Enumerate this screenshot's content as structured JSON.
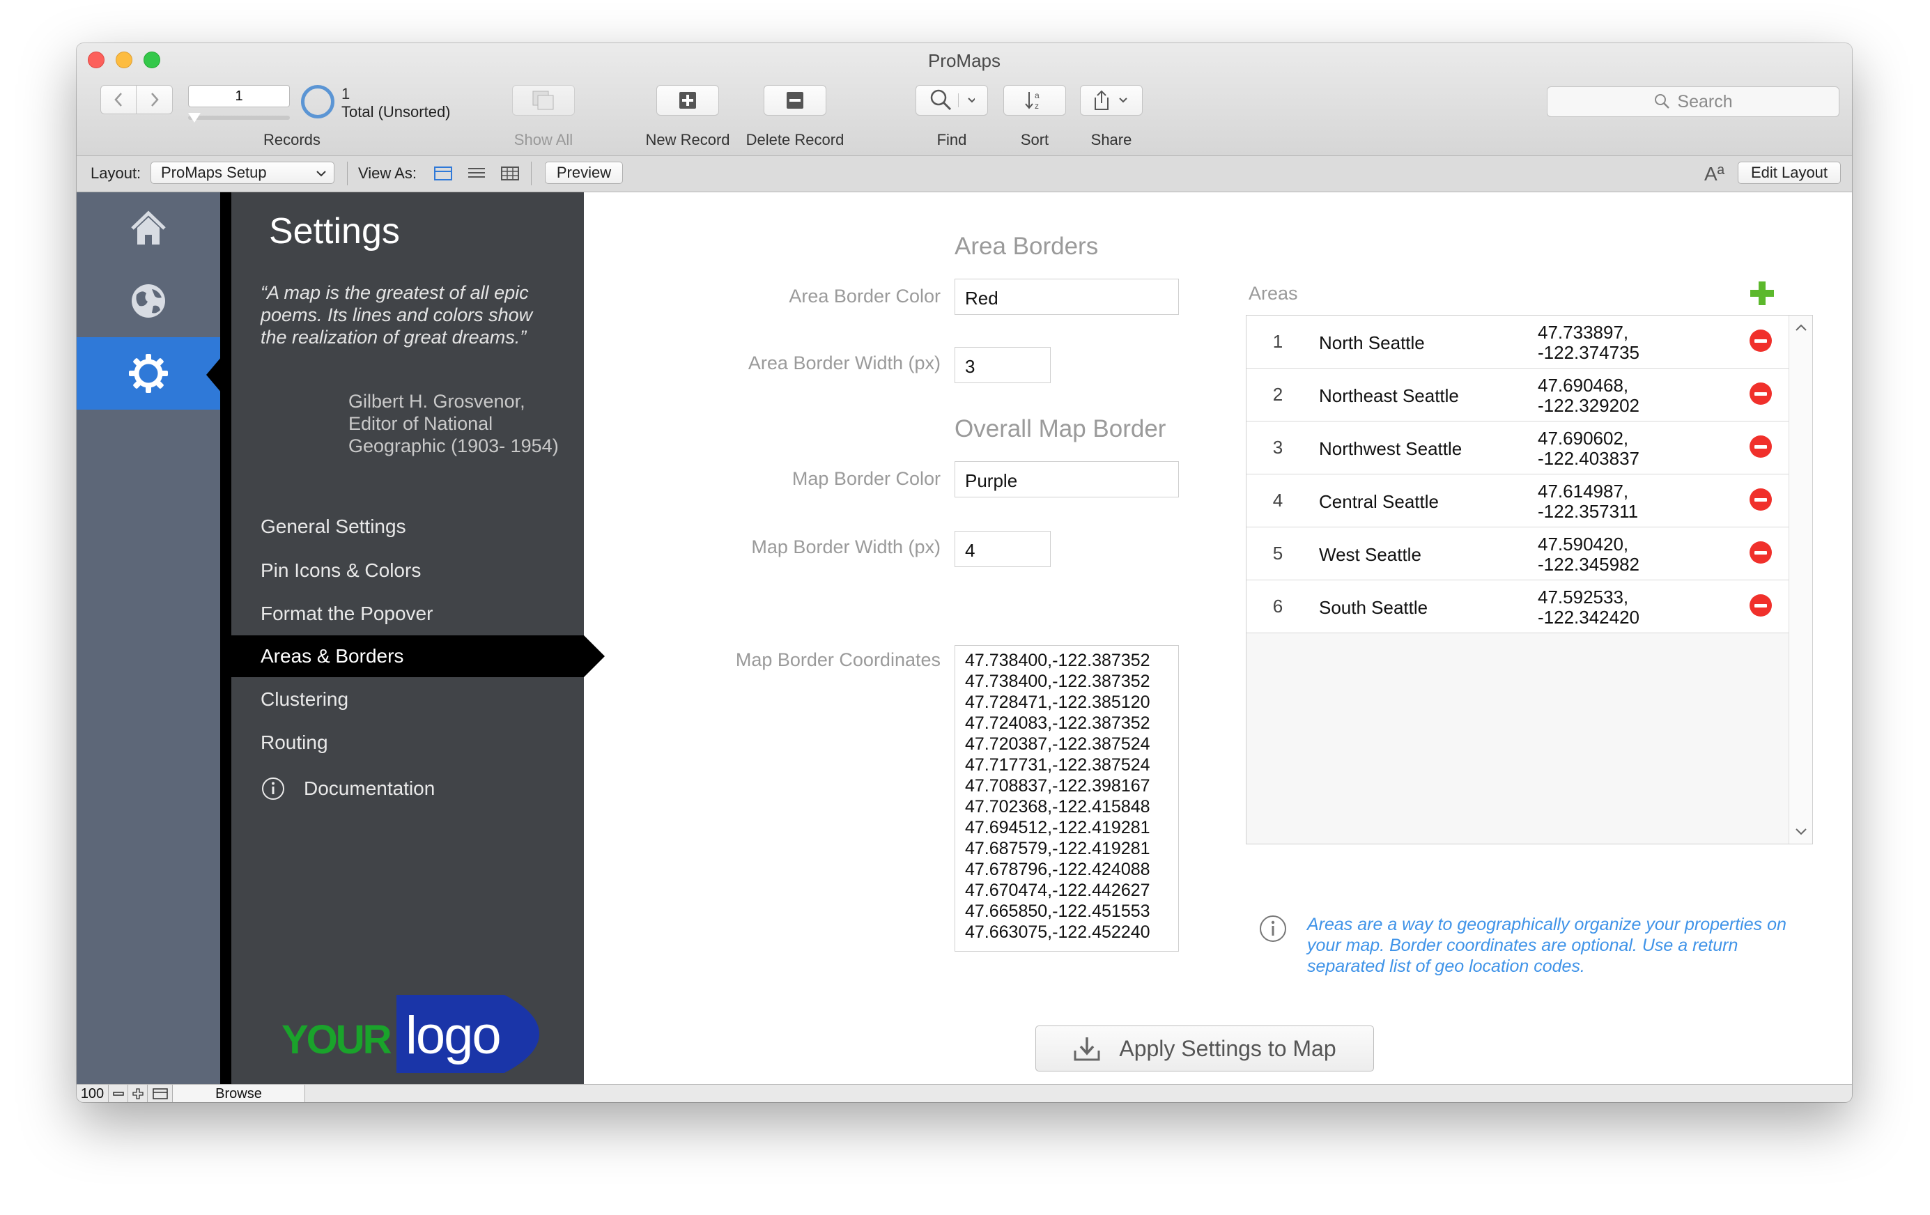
{
  "window": {
    "title": "ProMaps"
  },
  "toolbar": {
    "record_number": "1",
    "records_label": "Records",
    "found_count": "1",
    "total_label": "Total (Unsorted)",
    "show_all_label": "Show All",
    "new_record_label": "New Record",
    "delete_record_label": "Delete Record",
    "find_label": "Find",
    "sort_label": "Sort",
    "share_label": "Share",
    "search_placeholder": "Search"
  },
  "layout_bar": {
    "layout_label": "Layout:",
    "layout_value": "ProMaps Setup",
    "view_as_label": "View As:",
    "preview_label": "Preview",
    "edit_layout_label": "Edit Layout"
  },
  "nav_rail": {
    "items": [
      {
        "icon": "home-icon"
      },
      {
        "icon": "globe-icon"
      },
      {
        "icon": "gear-icon",
        "active": true
      }
    ]
  },
  "settings_panel": {
    "title": "Settings",
    "quote": "“A map is the greatest of all epic poems. Its lines and colors show the realization of great dreams.”",
    "author": "Gilbert H. Grosvenor, Editor of National Geographic (1903- 1954)",
    "menu": [
      {
        "label": "General Settings"
      },
      {
        "label": "Pin Icons & Colors"
      },
      {
        "label": "Format the Popover"
      },
      {
        "label": "Areas & Borders",
        "active": true
      },
      {
        "label": "Clustering"
      },
      {
        "label": "Routing"
      },
      {
        "label": "Documentation",
        "icon": "info-icon"
      }
    ],
    "logo": {
      "your": "YOUR",
      "logo": "logo"
    }
  },
  "form": {
    "area_borders_heading": "Area Borders",
    "area_border_color_label": "Area Border Color",
    "area_border_color_value": "Red",
    "area_border_width_label": "Area Border Width (px)",
    "area_border_width_value": "3",
    "overall_heading": "Overall Map Border",
    "map_border_color_label": "Map Border Color",
    "map_border_color_value": "Purple",
    "map_border_width_label": "Map Border Width (px)",
    "map_border_width_value": "4",
    "map_border_coords_label": "Map Border Coordinates",
    "map_border_coords": [
      "47.738400,-122.387352",
      "47.738400,-122.387352",
      "47.728471,-122.385120",
      "47.724083,-122.387352",
      "47.720387,-122.387524",
      "47.717731,-122.387524",
      "47.708837,-122.398167",
      "47.702368,-122.415848",
      "47.694512,-122.419281",
      "47.687579,-122.419281",
      "47.678796,-122.424088",
      "47.670474,-122.442627",
      "47.665850,-122.451553",
      "47.663075,-122.452240"
    ]
  },
  "areas": {
    "label": "Areas",
    "rows": [
      {
        "num": "1",
        "name": "North Seattle",
        "lat": "47.733897,",
        "lng": "-122.374735"
      },
      {
        "num": "2",
        "name": "Northeast Seattle",
        "lat": "47.690468,",
        "lng": "-122.329202"
      },
      {
        "num": "3",
        "name": "Northwest Seattle",
        "lat": "47.690602,",
        "lng": "-122.403837"
      },
      {
        "num": "4",
        "name": "Central Seattle",
        "lat": "47.614987,",
        "lng": "-122.357311"
      },
      {
        "num": "5",
        "name": "West Seattle",
        "lat": "47.590420,",
        "lng": "-122.345982"
      },
      {
        "num": "6",
        "name": "South Seattle",
        "lat": "47.592533,",
        "lng": "-122.342420"
      }
    ],
    "info": "Areas are a way to geographically organize your properties on your map. Border coordinates are optional. Use a return separated list of geo location codes."
  },
  "apply_button": {
    "label": "Apply Settings to Map"
  },
  "status_bar": {
    "zoom": "100",
    "mode": "Browse"
  },
  "colors": {
    "nav_rail": "#5d6778",
    "nav_active": "#2f79d8",
    "panel_bg": "#414448",
    "info_blue": "#3f93e8",
    "delete_red": "#f0302b",
    "add_green": "#5cb82c"
  }
}
